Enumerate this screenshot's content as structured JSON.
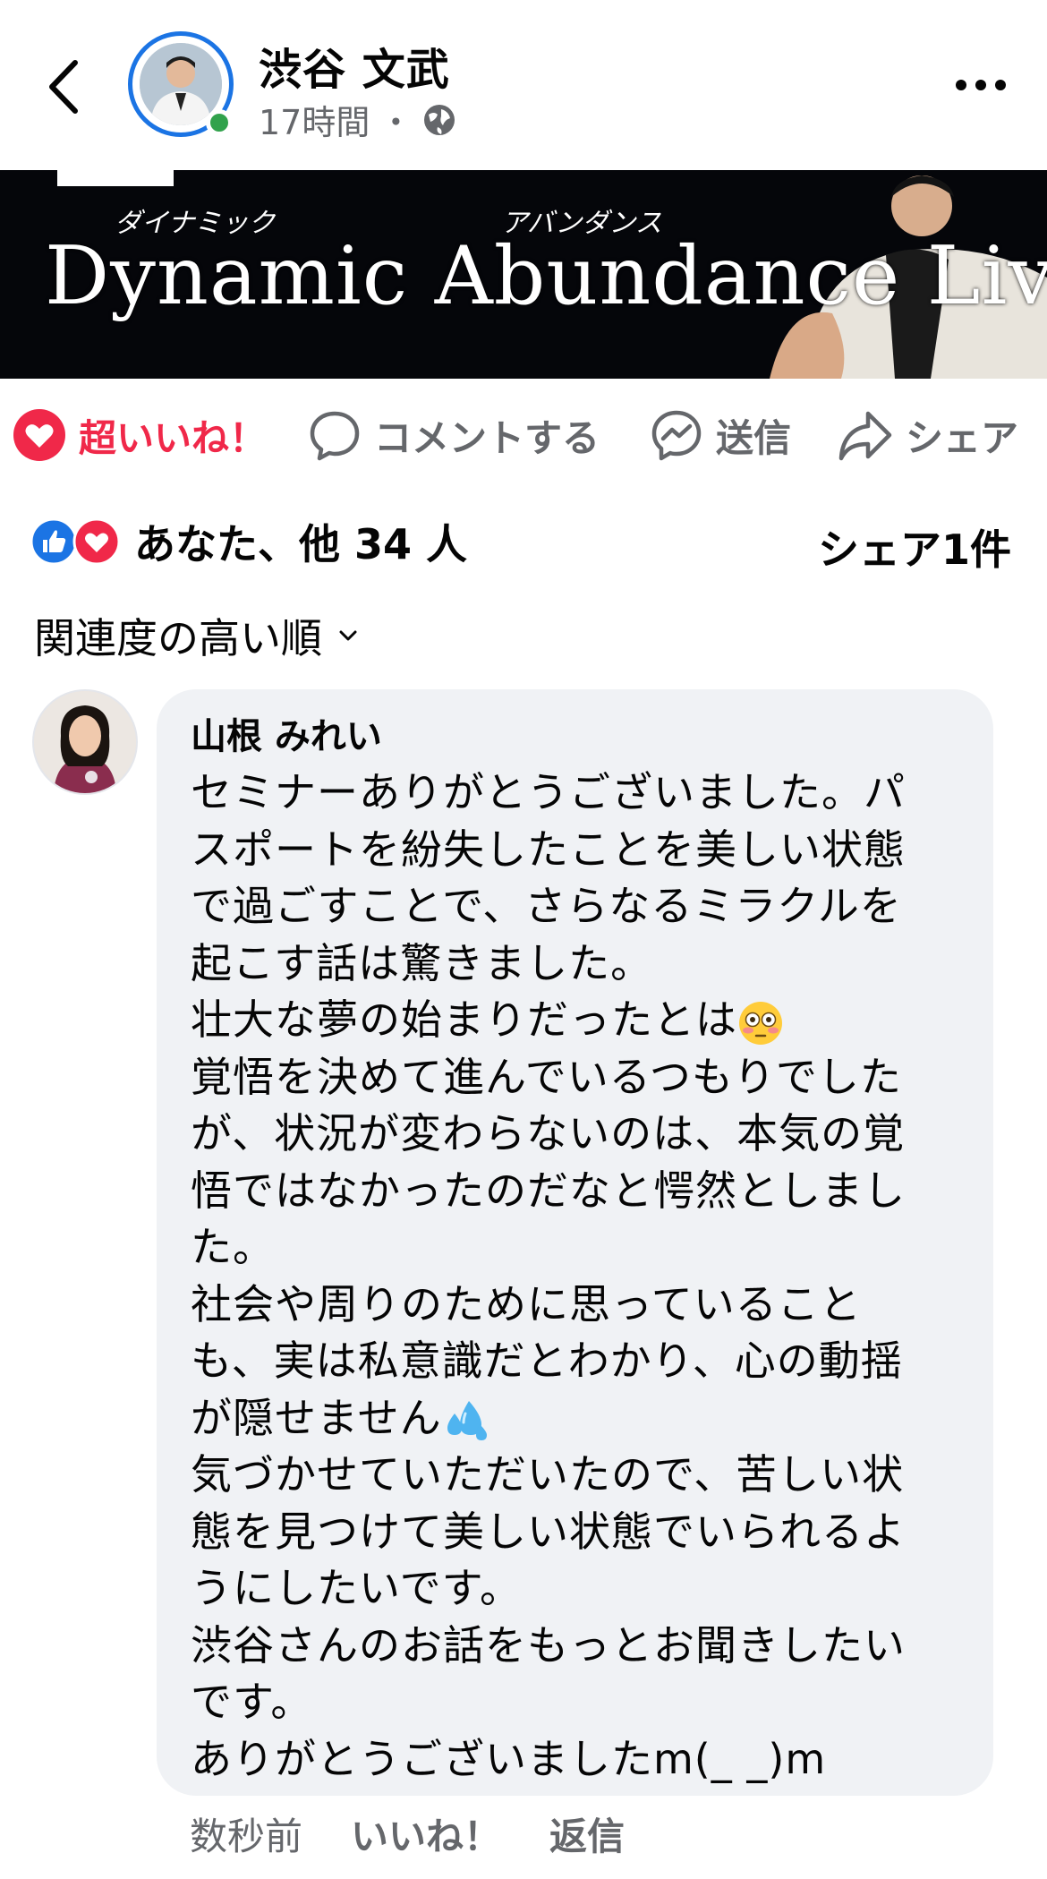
{
  "post": {
    "author": "渋谷 文武",
    "time": "17時間",
    "separator": "・",
    "privacy_icon": "globe-icon"
  },
  "banner": {
    "title": "Dynamic Abundance Live",
    "ruby_dynamic": "ダイナミック",
    "ruby_abundance": "アバンダンス"
  },
  "actions": {
    "love": "超いいね！",
    "comment": "コメントする",
    "send": "送信",
    "share": "シェア"
  },
  "reactions": {
    "summary": "あなた、他 34 人",
    "shares": "シェア1件"
  },
  "sort": {
    "label": "関連度の高い順"
  },
  "comment": {
    "author": "山根 みれい",
    "lines": [
      "セミナーありがとうございました。パ",
      "スポートを紛失したことを美しい状態",
      "で過ごすことで、さらなるミラクルを",
      "起こす話は驚きました。",
      "壮大な夢の始まりだったとは",
      "覚悟を決めて進んでいるつもりでした",
      "が、状況が変わらないのは、本気の覚",
      "悟ではなかったのだなと愕然としまし",
      "た。",
      "社会や周りのために思っていること",
      "も、実は私意識だとわかり、心の動揺",
      "が隠せません",
      "気づかせていただいたので、苦しい状",
      "態を見つけて美しい状態でいられるよ",
      "うにしたいです。",
      "渋谷さんのお話をもっとお聞きしたい",
      "です。",
      "ありがとうございましたm(_ _)m"
    ],
    "time": "数秒前",
    "like": "いいね！",
    "reply": "返信"
  },
  "colors": {
    "love": "#f02849",
    "like_blue": "#1b74e4",
    "muted": "#65676b",
    "bubble": "#f0f2f5"
  }
}
